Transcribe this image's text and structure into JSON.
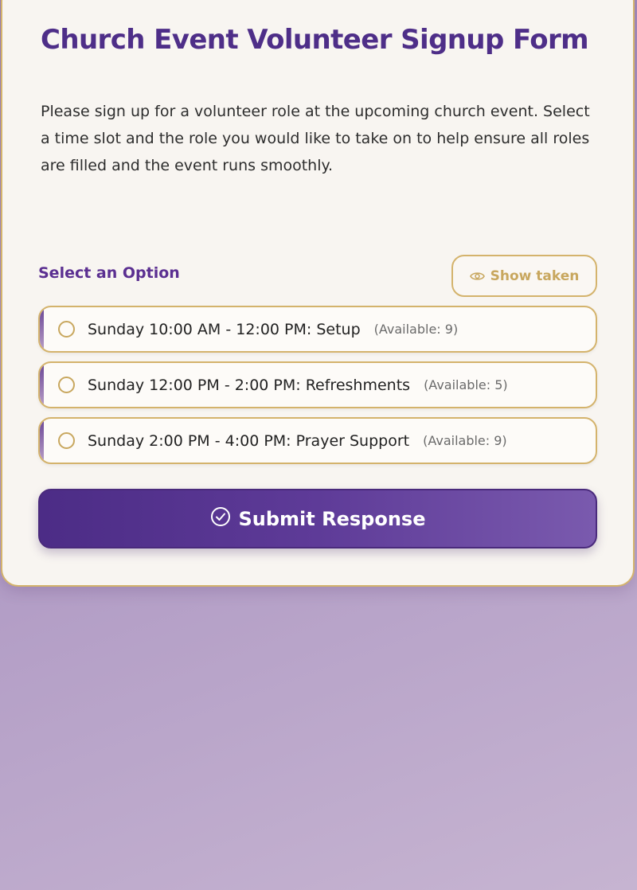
{
  "form": {
    "title": "Church Event Volunteer Signup Form",
    "description": "Please sign up for a volunteer role at the upcoming church event. Select a time slot and the role you would like to take on to help ensure all roles are filled and the event runs smoothly.",
    "section_label": "Select an Option",
    "show_taken_label": "Show taken",
    "show_taken_icon": "eye-icon",
    "options": [
      {
        "label": "Sunday 10:00 AM - 12:00 PM: Setup",
        "available": "(Available: 9)"
      },
      {
        "label": "Sunday 12:00 PM - 2:00 PM: Refreshments",
        "available": "(Available: 5)"
      },
      {
        "label": "Sunday 2:00 PM - 4:00 PM: Prayer Support",
        "available": "(Available: 9)"
      }
    ],
    "submit_label": "Submit Response",
    "submit_icon": "check-circle-icon"
  },
  "colors": {
    "primary": "#4e2e88",
    "accent_gold": "#d4b36c",
    "card_bg": "#f8f5f1",
    "page_bg": "#b39ec6"
  }
}
